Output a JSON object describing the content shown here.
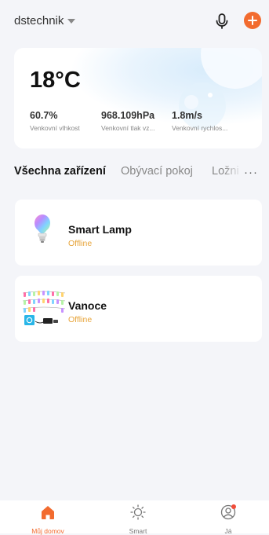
{
  "header": {
    "home_name": "dstechnik",
    "mic_icon": "microphone-icon",
    "add_icon": "plus-circle-icon",
    "accent": "#f26b2f"
  },
  "weather": {
    "temperature": "18°C",
    "stats": [
      {
        "value": "60.7%",
        "label": "Venkovní vlhkost"
      },
      {
        "value": "968.109hPa",
        "label": "Venkovní tlak vz..."
      },
      {
        "value": "1.8m/s",
        "label": "Venkovní rychlos..."
      }
    ]
  },
  "tabs": {
    "items": [
      "Všechna zařízení",
      "Obývací pokoj",
      "Ložni"
    ],
    "more": "···"
  },
  "devices": [
    {
      "name": "Smart Lamp",
      "status": "Offline",
      "icon": "smart-bulb-icon"
    },
    {
      "name": "Vanoce",
      "status": "Offline",
      "icon": "light-strip-icon"
    }
  ],
  "status_color": "#e7a43a",
  "nav": {
    "items": [
      {
        "label": "Můj domov",
        "icon": "home-icon",
        "active": true
      },
      {
        "label": "Smart",
        "icon": "sun-icon",
        "active": false
      },
      {
        "label": "Já",
        "icon": "profile-icon",
        "active": false
      }
    ]
  }
}
